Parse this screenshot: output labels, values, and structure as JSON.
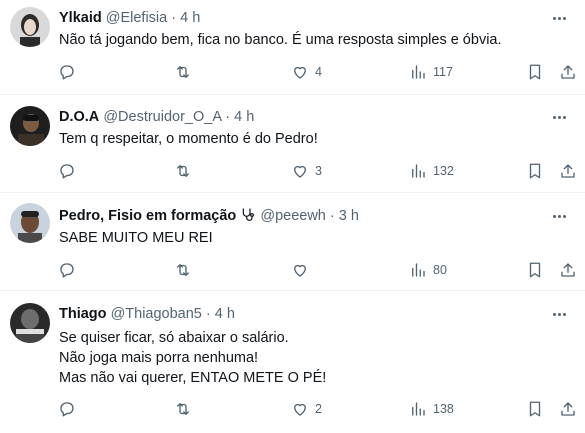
{
  "tweets": [
    {
      "name": "Ylkaid",
      "handle": "@Elefisia",
      "dot": "·",
      "time": "4 h",
      "lines": [
        "Não tá jogando bem, fica no banco. É uma resposta simples e óbvia."
      ],
      "likes": "4",
      "views": "117",
      "avatar_colors": [
        "#d9d9d9",
        "#2b2b2b"
      ]
    },
    {
      "name": "D.O.A",
      "handle": "@Destruidor_O_A",
      "dot": "·",
      "time": "4 h",
      "lines": [
        "Tem q respeitar, o momento é do Pedro!"
      ],
      "likes": "3",
      "views": "132",
      "avatar_colors": [
        "#1e1e1e",
        "#3a3026"
      ]
    },
    {
      "name": "Pedro, Fisio em formação",
      "badge_icon": "stethoscope-icon",
      "handle": "@peeewh",
      "dot": "·",
      "time": "3 h",
      "lines": [
        "SABE MUITO MEU REI"
      ],
      "likes": "",
      "views": "80",
      "avatar_colors": [
        "#c9d3dd",
        "#6b4a36"
      ]
    },
    {
      "name": "Thiago",
      "handle": "@Thiagoban5",
      "dot": "·",
      "time": "4 h",
      "lines": [
        "Se quiser ficar, só abaixar o salário.",
        "Não joga mais porra nenhuma!",
        "Mas não vai querer, ENTAO METE O PÉ!"
      ],
      "likes": "2",
      "views": "138",
      "avatar_colors": [
        "#2a2a2a",
        "#6d6d6d"
      ]
    }
  ],
  "colors": {
    "text": "#0f1419",
    "muted": "#536471",
    "divider": "#eff3f4"
  }
}
